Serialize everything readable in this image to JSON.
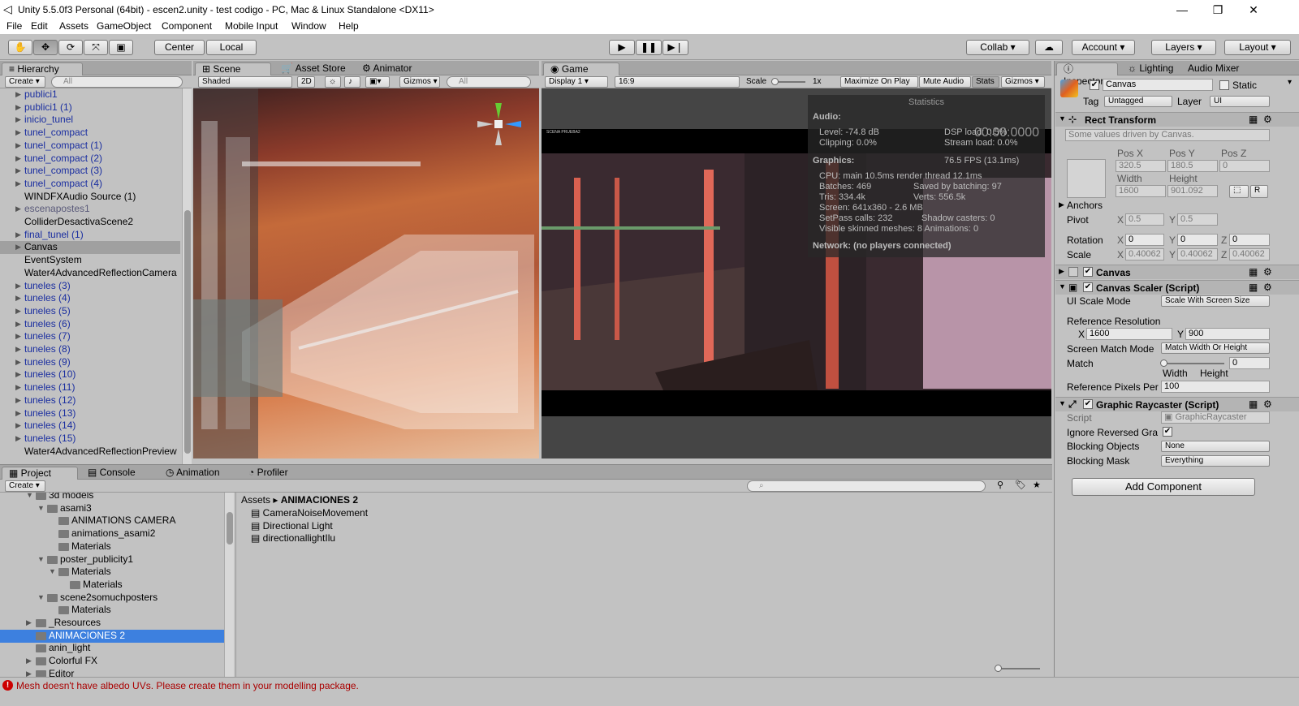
{
  "window": {
    "title": "Unity 5.5.0f3 Personal (64bit) - escen2.unity - test codigo - PC, Mac & Linux Standalone <DX11>"
  },
  "menu": [
    "File",
    "Edit",
    "Assets",
    "GameObject",
    "Component",
    "Mobile Input",
    "Window",
    "Help"
  ],
  "toolbar": {
    "center": "Center",
    "local": "Local",
    "collab": "Collab",
    "account": "Account",
    "layers": "Layers",
    "layout": "Layout"
  },
  "hierarchy": {
    "tab": "Hierarchy",
    "create": "Create",
    "search": "All",
    "items": [
      {
        "label": "publici1",
        "blue": true,
        "arrow": true
      },
      {
        "label": "publici1 (1)",
        "blue": true,
        "arrow": true
      },
      {
        "label": "inicio_tunel",
        "blue": true,
        "arrow": true
      },
      {
        "label": "tunel_compact",
        "blue": true,
        "arrow": true
      },
      {
        "label": "tunel_compact (1)",
        "blue": true,
        "arrow": true
      },
      {
        "label": "tunel_compact (2)",
        "blue": true,
        "arrow": true
      },
      {
        "label": "tunel_compact (3)",
        "blue": true,
        "arrow": true
      },
      {
        "label": "tunel_compact (4)",
        "blue": true,
        "arrow": true
      },
      {
        "label": "WINDFXAudio Source (1)",
        "blue": false,
        "arrow": false
      },
      {
        "label": "escenapostes1",
        "blue": false,
        "gray": true,
        "arrow": true
      },
      {
        "label": "ColliderDesactivaScene2",
        "blue": false,
        "arrow": false
      },
      {
        "label": "final_tunel (1)",
        "blue": true,
        "arrow": true
      },
      {
        "label": "Canvas",
        "blue": false,
        "arrow": true,
        "selected": true
      },
      {
        "label": "EventSystem",
        "blue": false,
        "arrow": false
      },
      {
        "label": "Water4AdvancedReflectionCamera",
        "blue": false,
        "arrow": false
      },
      {
        "label": "tuneles (3)",
        "blue": true,
        "arrow": true
      },
      {
        "label": "tuneles (4)",
        "blue": true,
        "arrow": true
      },
      {
        "label": "tuneles (5)",
        "blue": true,
        "arrow": true
      },
      {
        "label": "tuneles (6)",
        "blue": true,
        "arrow": true
      },
      {
        "label": "tuneles (7)",
        "blue": true,
        "arrow": true
      },
      {
        "label": "tuneles (8)",
        "blue": true,
        "arrow": true
      },
      {
        "label": "tuneles (9)",
        "blue": true,
        "arrow": true
      },
      {
        "label": "tuneles (10)",
        "blue": true,
        "arrow": true
      },
      {
        "label": "tuneles (11)",
        "blue": true,
        "arrow": true
      },
      {
        "label": "tuneles (12)",
        "blue": true,
        "arrow": true
      },
      {
        "label": "tuneles (13)",
        "blue": true,
        "arrow": true
      },
      {
        "label": "tuneles (14)",
        "blue": true,
        "arrow": true
      },
      {
        "label": "tuneles (15)",
        "blue": true,
        "arrow": true
      },
      {
        "label": "Water4AdvancedReflectionPreview",
        "blue": false,
        "arrow": false
      }
    ]
  },
  "scene": {
    "tabs": [
      "Scene",
      "Asset Store",
      "Animator"
    ],
    "shaded": "Shaded",
    "mode2d": "2D",
    "gizmos": "Gizmos",
    "search": "All"
  },
  "game": {
    "tab": "Game",
    "display": "Display 1",
    "aspect": "16:9",
    "scale_label": "Scale",
    "scale_value": "1x",
    "buttons": [
      "Maximize On Play",
      "Mute Audio",
      "Stats",
      "Gizmos"
    ],
    "stats": {
      "title": "Statistics",
      "audio_h": "Audio:",
      "level": "Level: -74.8 dB",
      "dsp": "DSP load: 0.5%",
      "clipping": "Clipping: 0.0%",
      "stream": "Stream load: 0.0%",
      "graphics_h": "Graphics:",
      "fps": "76.5 FPS (13.1ms)",
      "cpu": "CPU: main 10.5ms  render thread 12.1ms",
      "batches": "Batches: 469",
      "saved": "Saved by batching: 97",
      "tris": "Tris: 334.4k",
      "verts": "Verts: 556.5k",
      "screen": "Screen: 641x360 - 2.6 MB",
      "setpass": "SetPass calls: 232",
      "shadow": "Shadow casters: 0",
      "skinned": "Visible skinned meshes: 8  Animations: 0",
      "network": "Network: (no players connected)",
      "overlay_time": "00:00:0000"
    },
    "in_game_text": "SCENA PRUEBA2"
  },
  "inspector": {
    "tabs": [
      "Inspector",
      "Lighting",
      "Audio Mixer"
    ],
    "object_name": "Canvas",
    "static": "Static",
    "tag_label": "Tag",
    "tag": "Untagged",
    "layer_label": "Layer",
    "layer": "UI",
    "rect_transform": {
      "title": "Rect Transform",
      "note": "Some values driven by Canvas.",
      "posx_l": "Pos X",
      "posy_l": "Pos Y",
      "posz_l": "Pos Z",
      "posx": "320.5",
      "posy": "180.5",
      "posz": "0",
      "width_l": "Width",
      "height_l": "Height",
      "width": "1600",
      "height": "901.092",
      "anchors": "Anchors",
      "pivot": "Pivot",
      "pivot_x": "0.5",
      "pivot_y": "0.5",
      "rotation": "Rotation",
      "rot_x": "0",
      "rot_y": "0",
      "rot_z": "0",
      "scale": "Scale",
      "scale_x": "0.40062",
      "scale_y": "0.40062",
      "scale_z": "0.40062",
      "r_btn": "R"
    },
    "canvas": {
      "title": "Canvas"
    },
    "scaler": {
      "title": "Canvas Scaler (Script)",
      "mode_l": "UI Scale Mode",
      "mode": "Scale With Screen Size",
      "ref_l": "Reference Resolution",
      "ref_x": "1600",
      "ref_y": "900",
      "match_mode_l": "Screen Match Mode",
      "match_mode": "Match Width Or Height",
      "match_l": "Match",
      "match": "0",
      "match_width": "Width",
      "match_height": "Height",
      "ppu_l": "Reference Pixels Per",
      "ppu": "100"
    },
    "raycaster": {
      "title": "Graphic Raycaster (Script)",
      "script_l": "Script",
      "script": "GraphicRaycaster",
      "ignore_l": "Ignore Reversed Gra",
      "blocking_l": "Blocking Objects",
      "blocking": "None",
      "mask_l": "Blocking Mask",
      "mask": "Everything"
    },
    "add_component": "Add Component"
  },
  "project": {
    "tabs": [
      "Project",
      "Console",
      "Animation",
      "Profiler"
    ],
    "create": "Create",
    "breadcrumb_root": "Assets",
    "breadcrumb_current": "ANIMACIONES 2",
    "tree": [
      {
        "label": "3d models",
        "indent": 1,
        "arrow": "down"
      },
      {
        "label": "asami3",
        "indent": 2,
        "arrow": "down"
      },
      {
        "label": "ANIMATIONS CAMERA",
        "indent": 3,
        "arrow": ""
      },
      {
        "label": "animations_asami2",
        "indent": 3,
        "arrow": ""
      },
      {
        "label": "Materials",
        "indent": 3,
        "arrow": ""
      },
      {
        "label": "poster_publicity1",
        "indent": 2,
        "arrow": "down"
      },
      {
        "label": "Materials",
        "indent": 3,
        "arrow": "down"
      },
      {
        "label": "Materials",
        "indent": 4,
        "arrow": ""
      },
      {
        "label": "scene2somuchposters",
        "indent": 2,
        "arrow": "down"
      },
      {
        "label": "Materials",
        "indent": 3,
        "arrow": ""
      },
      {
        "label": "_Resources",
        "indent": 1,
        "arrow": "right"
      },
      {
        "label": "ANIMACIONES 2",
        "indent": 1,
        "arrow": "",
        "selected": true
      },
      {
        "label": "anin_light",
        "indent": 1,
        "arrow": ""
      },
      {
        "label": "Colorful FX",
        "indent": 1,
        "arrow": "right"
      },
      {
        "label": "Editor",
        "indent": 1,
        "arrow": "right"
      }
    ],
    "assets": [
      "CameraNoiseMovement",
      "Directional Light",
      "directionallightIlu"
    ]
  },
  "status": {
    "message": "Mesh doesn't have albedo UVs. Please create them in your modelling package."
  }
}
